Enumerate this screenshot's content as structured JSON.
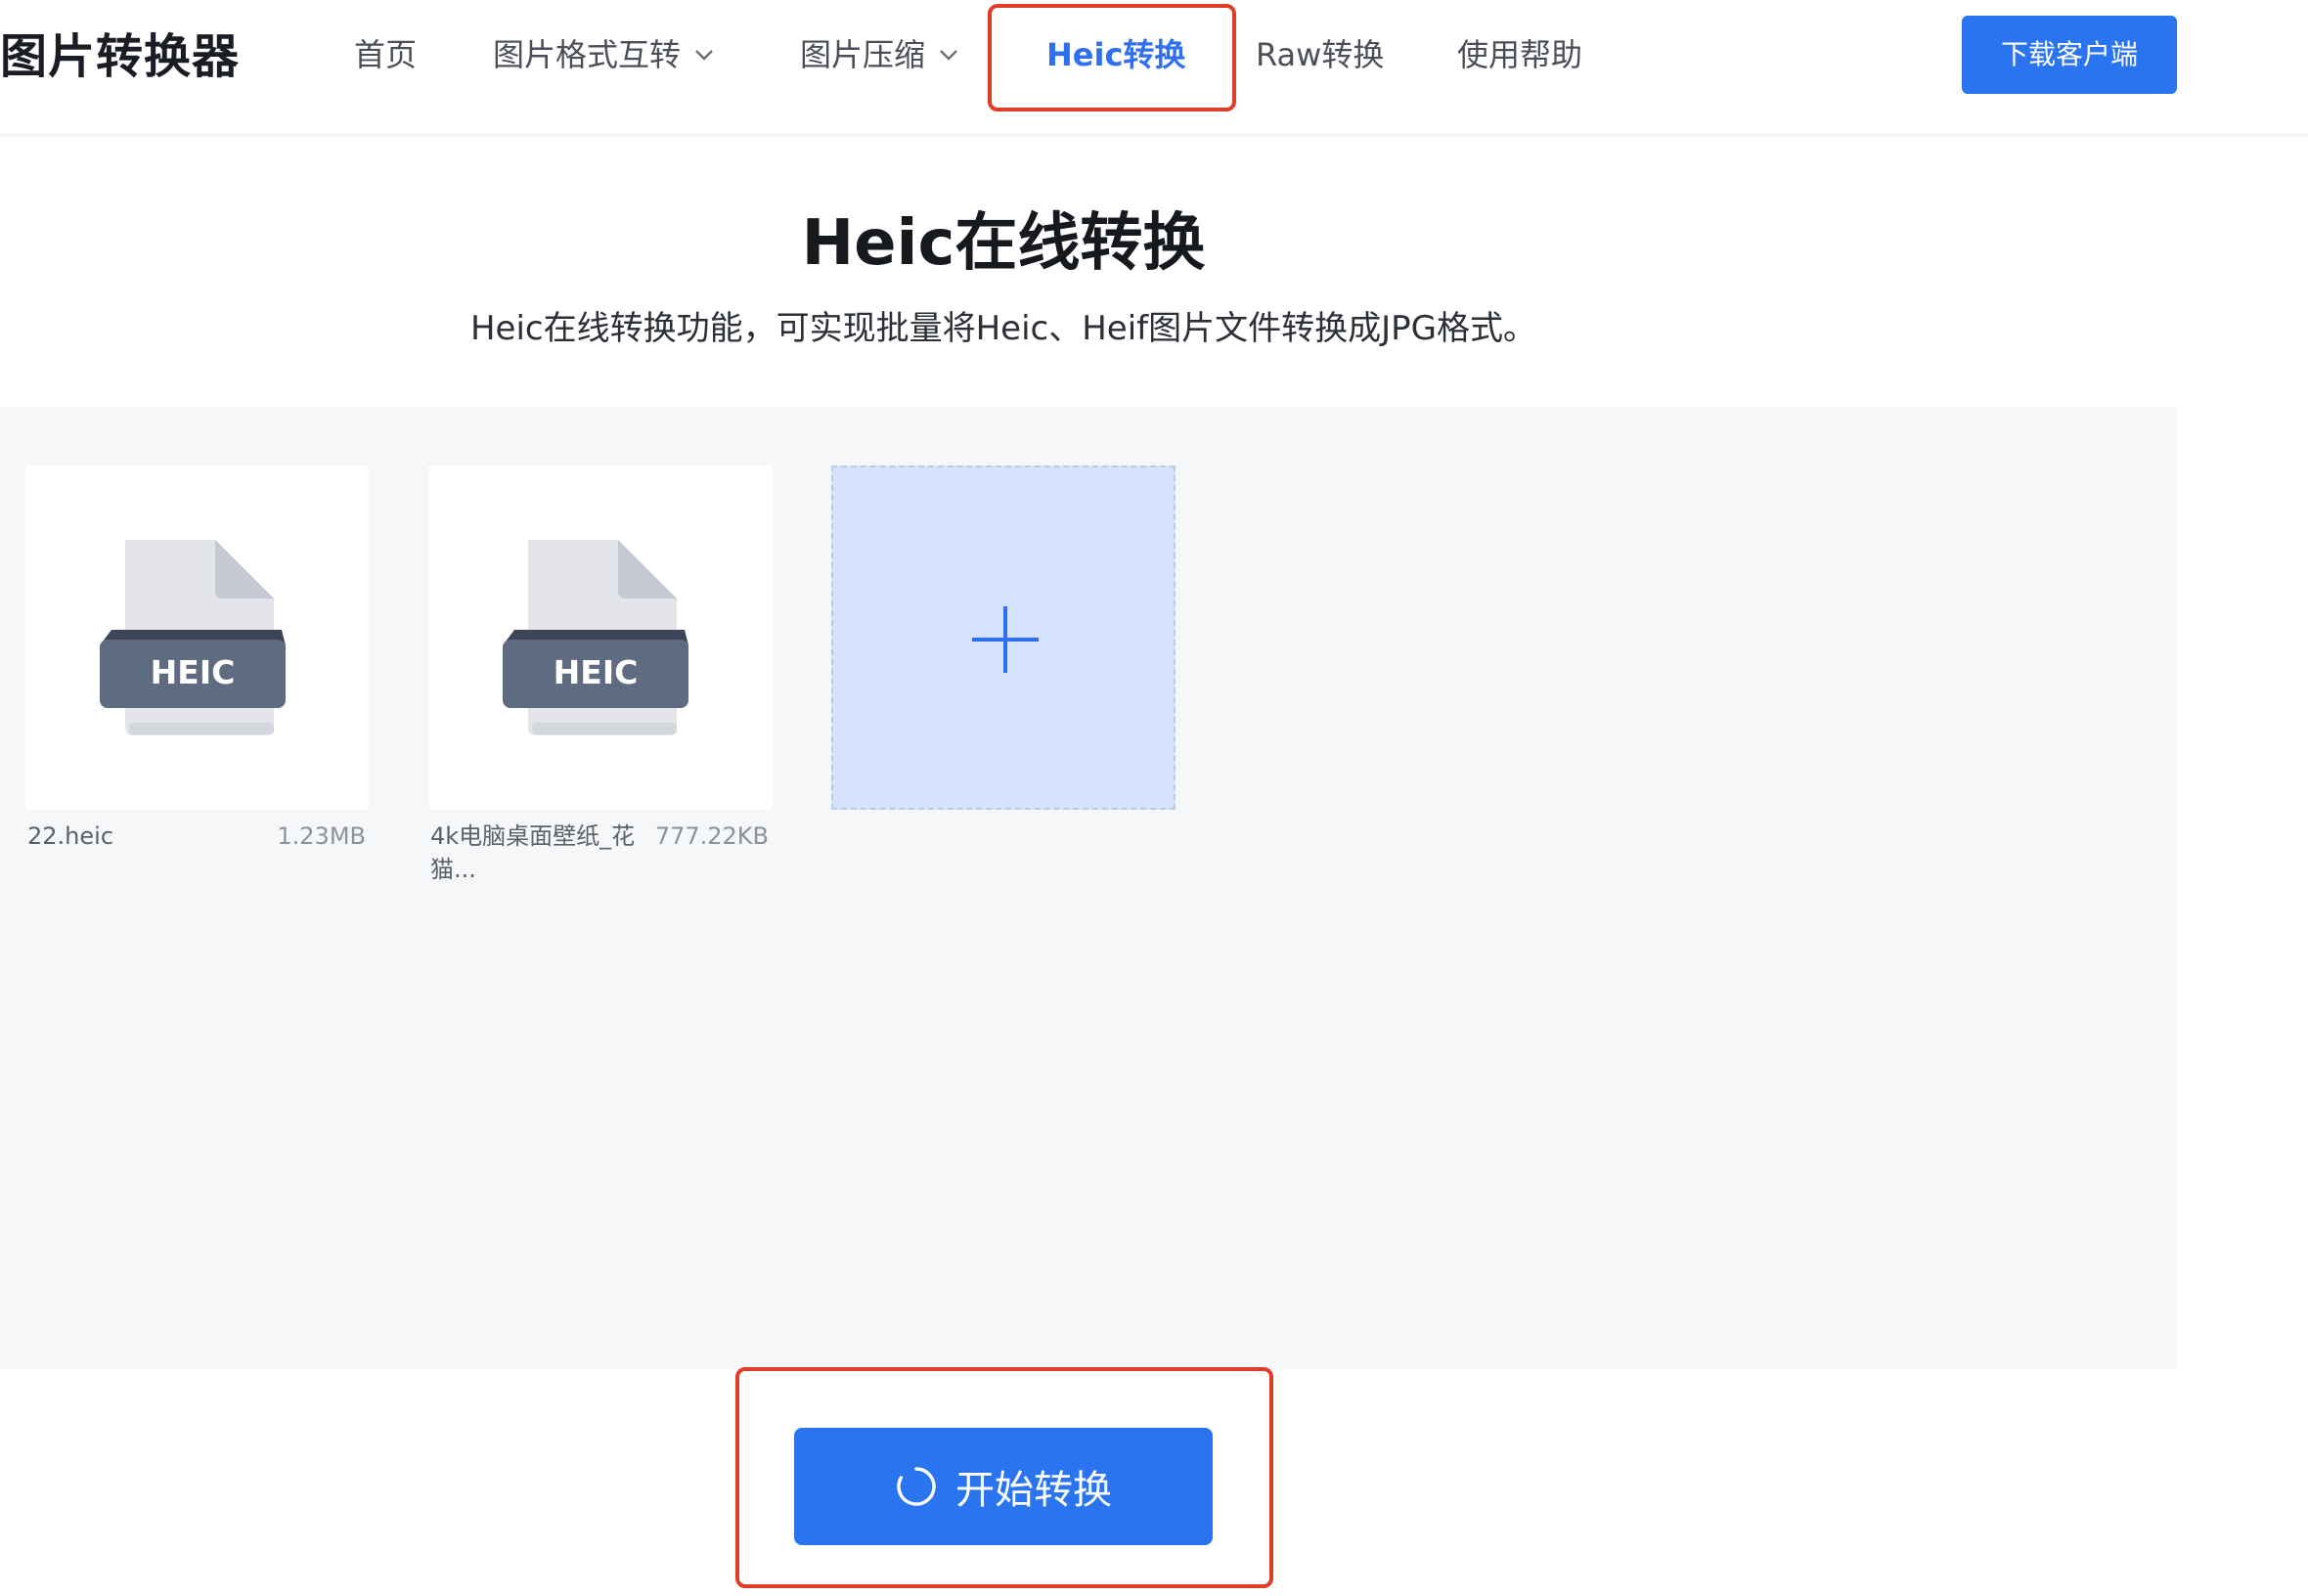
{
  "header": {
    "logo": "图片转换器",
    "nav": [
      {
        "label": "首页"
      },
      {
        "label": "图片格式互转"
      },
      {
        "label": "图片压缩"
      },
      {
        "label": "Heic转换"
      },
      {
        "label": "Raw转换"
      },
      {
        "label": "使用帮助"
      }
    ],
    "active_nav": "Heic转换",
    "download_label": "下载客户端"
  },
  "hero": {
    "title": "Heic在线转换",
    "subtitle": "Heic在线转换功能，可实现批量将Heic、Heif图片文件转换成JPG格式。"
  },
  "upload": {
    "files": [
      {
        "icon_label": "HEIC",
        "name": "22.heic",
        "size": "1.23MB"
      },
      {
        "icon_label": "HEIC",
        "name": "4k电脑桌面壁纸_花\n猫...",
        "size": "777.22KB"
      }
    ],
    "add_icon": "plus-icon"
  },
  "action": {
    "start_label": "开始转换",
    "start_icon": "loading-spinner-icon"
  },
  "colors": {
    "accent": "#2b74f0",
    "highlight": "#e23b26",
    "area_bg": "#f6f7f9",
    "add_tile_bg": "#d5e3fc"
  }
}
